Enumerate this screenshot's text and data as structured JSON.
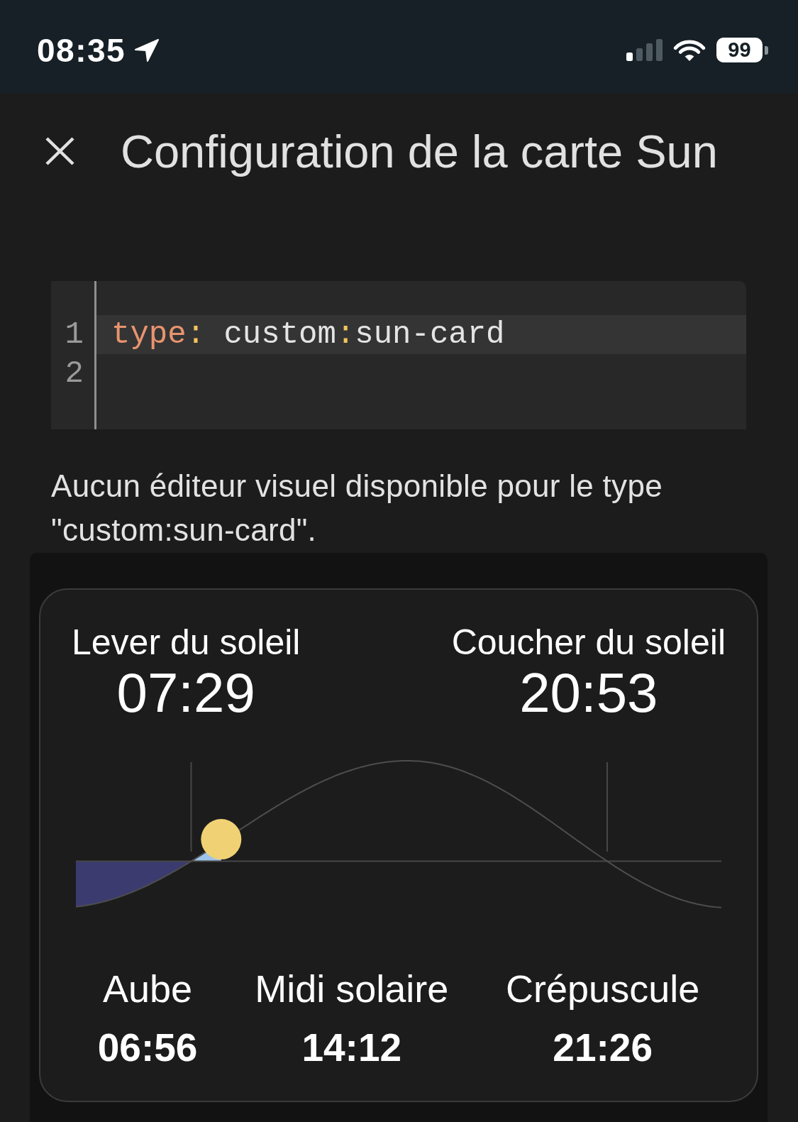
{
  "status_bar": {
    "time": "08:35",
    "battery": "99"
  },
  "header": {
    "title": "Configuration de la carte Sun"
  },
  "code_editor": {
    "lines": [
      {
        "number": "1",
        "active": true,
        "tokens": [
          {
            "kind": "key",
            "text": "type"
          },
          {
            "kind": "punct",
            "text": ": "
          },
          {
            "kind": "plain",
            "text": "custom"
          },
          {
            "kind": "punct",
            "text": ":"
          },
          {
            "kind": "plain",
            "text": "sun-card"
          }
        ]
      },
      {
        "number": "2",
        "active": false
      }
    ]
  },
  "message": "Aucun éditeur visuel disponible pour le type \"custom:sun-card\".",
  "sun_card": {
    "events": [
      {
        "label": "Lever du soleil",
        "time": "07:29"
      },
      {
        "label": "Coucher du soleil",
        "time": "20:53"
      }
    ],
    "sun": {
      "level": 0.225
    },
    "times": [
      {
        "label": "Aube",
        "time": "06:56"
      },
      {
        "label": "Midi solaire",
        "time": "14:12"
      },
      {
        "label": "Crépuscule",
        "time": "21:26"
      }
    ]
  }
}
